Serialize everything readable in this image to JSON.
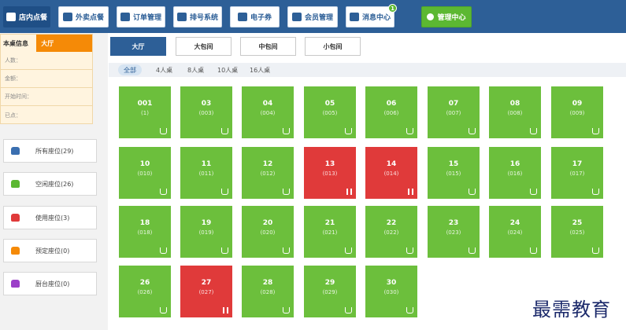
{
  "nav": {
    "items": [
      {
        "label": "店内点餐",
        "icon": "store-icon"
      },
      {
        "label": "外卖点餐",
        "icon": "delivery-icon"
      },
      {
        "label": "订单管理",
        "icon": "order-icon"
      },
      {
        "label": "排号系统",
        "icon": "queue-icon"
      },
      {
        "label": "电子券",
        "icon": "coupon-icon"
      },
      {
        "label": "会员管理",
        "icon": "member-icon"
      },
      {
        "label": "消息中心",
        "icon": "message-icon",
        "badge": "1"
      },
      {
        "label": "管理中心",
        "icon": "settings-icon"
      }
    ]
  },
  "info": {
    "title": "本桌信息",
    "tab": "大厅",
    "rows": [
      "人数：",
      "金额：",
      "开始时间：",
      "已点："
    ]
  },
  "seat_filters": [
    {
      "label": "所有座位(29)",
      "color": "#3a6fb0"
    },
    {
      "label": "空闲座位(26)",
      "color": "#5cb832"
    },
    {
      "label": "使用座位(3)",
      "color": "#e03a3a"
    },
    {
      "label": "预定座位(0)",
      "color": "#f58a07"
    },
    {
      "label": "厨台座位(0)",
      "color": "#9b3fc8"
    }
  ],
  "room_tabs": [
    "大厅",
    "大包间",
    "中包间",
    "小包间"
  ],
  "size_filters": [
    "全部",
    "4人桌",
    "8人桌",
    "10人桌",
    "16人桌"
  ],
  "tables": [
    {
      "num": "001",
      "code": "(1)",
      "status": "free"
    },
    {
      "num": "03",
      "code": "(003)",
      "status": "free"
    },
    {
      "num": "04",
      "code": "(004)",
      "status": "free"
    },
    {
      "num": "05",
      "code": "(005)",
      "status": "free"
    },
    {
      "num": "06",
      "code": "(006)",
      "status": "free"
    },
    {
      "num": "07",
      "code": "(007)",
      "status": "free"
    },
    {
      "num": "08",
      "code": "(008)",
      "status": "free"
    },
    {
      "num": "09",
      "code": "(009)",
      "status": "free"
    },
    {
      "num": "10",
      "code": "(010)",
      "status": "free"
    },
    {
      "num": "11",
      "code": "(011)",
      "status": "free"
    },
    {
      "num": "12",
      "code": "(012)",
      "status": "free"
    },
    {
      "num": "13",
      "code": "(013)",
      "status": "busy"
    },
    {
      "num": "14",
      "code": "(014)",
      "status": "busy"
    },
    {
      "num": "15",
      "code": "(015)",
      "status": "free"
    },
    {
      "num": "16",
      "code": "(016)",
      "status": "free"
    },
    {
      "num": "17",
      "code": "(017)",
      "status": "free"
    },
    {
      "num": "18",
      "code": "(018)",
      "status": "free"
    },
    {
      "num": "19",
      "code": "(019)",
      "status": "free"
    },
    {
      "num": "20",
      "code": "(020)",
      "status": "free"
    },
    {
      "num": "21",
      "code": "(021)",
      "status": "free"
    },
    {
      "num": "22",
      "code": "(022)",
      "status": "free"
    },
    {
      "num": "23",
      "code": "(023)",
      "status": "free"
    },
    {
      "num": "24",
      "code": "(024)",
      "status": "free"
    },
    {
      "num": "25",
      "code": "(025)",
      "status": "free"
    },
    {
      "num": "26",
      "code": "(026)",
      "status": "free"
    },
    {
      "num": "27",
      "code": "(027)",
      "status": "busy"
    },
    {
      "num": "28",
      "code": "(028)",
      "status": "free"
    },
    {
      "num": "29",
      "code": "(029)",
      "status": "free"
    },
    {
      "num": "30",
      "code": "(030)",
      "status": "free"
    }
  ],
  "watermark": "最需教育",
  "colors": {
    "primary": "#2d5f97",
    "free": "#6cbf3c",
    "busy": "#e03a3a",
    "accent": "#f58a07"
  }
}
